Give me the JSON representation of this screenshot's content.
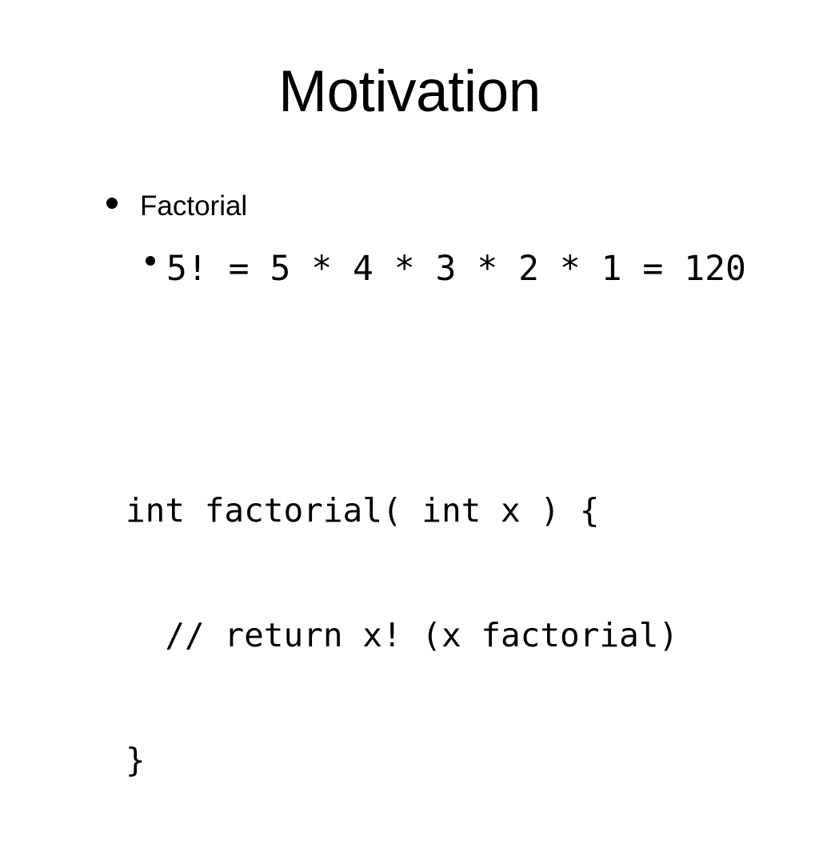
{
  "slide": {
    "title": "Motivation",
    "background_color": "#ffffff",
    "text_color": "#000000",
    "bullets": [
      {
        "level": 1,
        "marker": "filled-circle",
        "text": "Factorial"
      },
      {
        "level": 2,
        "marker": "filled-circle",
        "text": "5! = 5 * 4 * 3 * 2 * 1 = 120"
      }
    ],
    "code_block": {
      "language": "c",
      "lines": [
        "int factorial( int x ) {",
        "  // return x! (x factorial)",
        "}"
      ]
    }
  }
}
